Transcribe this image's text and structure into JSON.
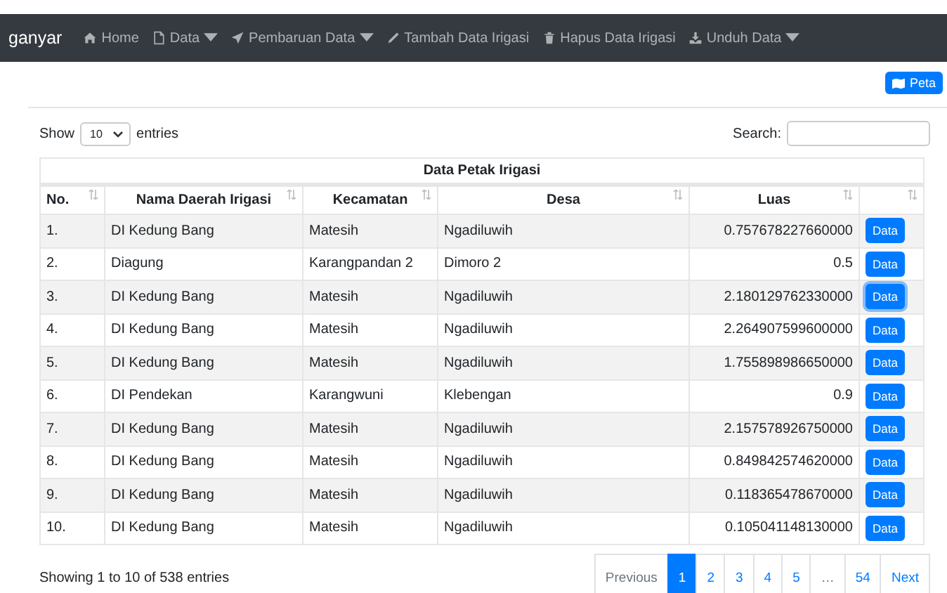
{
  "navbar": {
    "brand": "ganyar",
    "items": [
      {
        "label": "Home",
        "dropdown": false
      },
      {
        "label": "Data",
        "dropdown": true
      },
      {
        "label": "Pembaruan Data",
        "dropdown": true
      },
      {
        "label": "Tambah Data Irigasi",
        "dropdown": false
      },
      {
        "label": "Hapus Data Irigasi",
        "dropdown": false
      },
      {
        "label": "Unduh Data",
        "dropdown": true
      }
    ]
  },
  "map_button": {
    "label": "Peta"
  },
  "length_menu": {
    "prefix": "Show",
    "value": "10",
    "suffix": "entries"
  },
  "search": {
    "label": "Search:"
  },
  "table": {
    "title": "Data Petak Irigasi",
    "columns": [
      "No.",
      "Nama Daerah Irigasi",
      "Kecamatan",
      "Desa",
      "Luas"
    ],
    "rows": [
      {
        "cells": [
          "1.",
          "DI Kedung Bang",
          "Matesih",
          "Ngadiluwih",
          "0.757678227660000"
        ],
        "button": "Data",
        "focused": false
      },
      {
        "cells": [
          "2.",
          "Diagung",
          "Karangpandan 2",
          "Dimoro 2",
          "0.5"
        ],
        "button": "Data",
        "focused": false
      },
      {
        "cells": [
          "3.",
          "DI Kedung Bang",
          "Matesih",
          "Ngadiluwih",
          "2.180129762330000"
        ],
        "button": "Data",
        "focused": true
      },
      {
        "cells": [
          "4.",
          "DI Kedung Bang",
          "Matesih",
          "Ngadiluwih",
          "2.264907599600000"
        ],
        "button": "Data",
        "focused": false
      },
      {
        "cells": [
          "5.",
          "DI Kedung Bang",
          "Matesih",
          "Ngadiluwih",
          "1.755898986650000"
        ],
        "button": "Data",
        "focused": false
      },
      {
        "cells": [
          "6.",
          "DI Pendekan",
          "Karangwuni",
          "Klebengan",
          "0.9"
        ],
        "button": "Data",
        "focused": false
      },
      {
        "cells": [
          "7.",
          "DI Kedung Bang",
          "Matesih",
          "Ngadiluwih",
          "2.157578926750000"
        ],
        "button": "Data",
        "focused": false
      },
      {
        "cells": [
          "8.",
          "DI Kedung Bang",
          "Matesih",
          "Ngadiluwih",
          "0.849842574620000"
        ],
        "button": "Data",
        "focused": false
      },
      {
        "cells": [
          "9.",
          "DI Kedung Bang",
          "Matesih",
          "Ngadiluwih",
          "0.118365478670000"
        ],
        "button": "Data",
        "focused": false
      },
      {
        "cells": [
          "10.",
          "DI Kedung Bang",
          "Matesih",
          "Ngadiluwih",
          "0.105041148130000"
        ],
        "button": "Data",
        "focused": false
      }
    ]
  },
  "info": "Showing 1 to 10 of 538 entries",
  "pagination": [
    {
      "label": "Previous",
      "kind": "nav",
      "selected": false
    },
    {
      "label": "1",
      "kind": "page",
      "selected": true
    },
    {
      "label": "2",
      "kind": "page",
      "selected": false
    },
    {
      "label": "3",
      "kind": "page",
      "selected": false
    },
    {
      "label": "4",
      "kind": "page",
      "selected": false
    },
    {
      "label": "5",
      "kind": "page",
      "selected": false
    },
    {
      "label": "…",
      "kind": "ellipsis",
      "selected": false
    },
    {
      "label": "54",
      "kind": "page",
      "selected": false
    },
    {
      "label": "Next",
      "kind": "nav",
      "selected": false
    }
  ]
}
